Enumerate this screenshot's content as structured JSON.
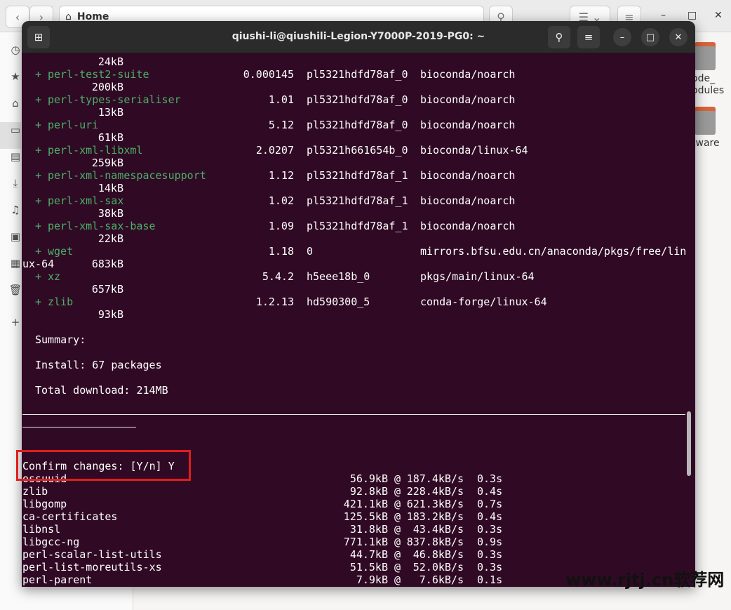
{
  "file_manager": {
    "path_label": "Home",
    "folders": [
      {
        "label": "ode_\nodules"
      },
      {
        "label": "tware"
      }
    ]
  },
  "terminal": {
    "title": "qiushi-li@qiushili-Legion-Y7000P-2019-PG0: ~",
    "packages": [
      {
        "name": "",
        "version": "",
        "build": "",
        "channel": "",
        "size": "24kB"
      },
      {
        "name": "perl-test2-suite",
        "version": "0.000145",
        "build": "pl5321hdfd78af_0",
        "channel": "bioconda/noarch",
        "size": "200kB"
      },
      {
        "name": "perl-types-serialiser",
        "version": "1.01",
        "build": "pl5321hdfd78af_0",
        "channel": "bioconda/noarch",
        "size": "13kB"
      },
      {
        "name": "perl-uri",
        "version": "5.12",
        "build": "pl5321hdfd78af_0",
        "channel": "bioconda/noarch",
        "size": "61kB"
      },
      {
        "name": "perl-xml-libxml",
        "version": "2.0207",
        "build": "pl5321h661654b_0",
        "channel": "bioconda/linux-64",
        "size": "259kB"
      },
      {
        "name": "perl-xml-namespacesupport",
        "version": "1.12",
        "build": "pl5321hdfd78af_1",
        "channel": "bioconda/noarch",
        "size": "14kB"
      },
      {
        "name": "perl-xml-sax",
        "version": "1.02",
        "build": "pl5321hdfd78af_1",
        "channel": "bioconda/noarch",
        "size": "38kB"
      },
      {
        "name": "perl-xml-sax-base",
        "version": "1.09",
        "build": "pl5321hdfd78af_1",
        "channel": "bioconda/noarch",
        "size": "22kB"
      },
      {
        "name": "wget",
        "version": "1.18",
        "build": "0",
        "channel": "mirrors.bfsu.edu.cn/anaconda/pkgs/free/lin",
        "wrap_prefix": "ux-64",
        "size": "683kB"
      },
      {
        "name": "xz",
        "version": "5.4.2",
        "build": "h5eee18b_0",
        "channel": "pkgs/main/linux-64",
        "size": "657kB"
      },
      {
        "name": "zlib",
        "version": "1.2.13",
        "build": "hd590300_5",
        "channel": "conda-forge/linux-64",
        "size": "93kB"
      }
    ],
    "summary_label": "Summary:",
    "install_line": "Install: 67 packages",
    "total_line": "Total download: 214MB",
    "confirm_line": "Confirm changes: [Y/n] Y",
    "downloads": [
      {
        "name": "ossuuid",
        "size": "56.9kB",
        "speed": "187.4kB/s",
        "time": "0.3s"
      },
      {
        "name": "zlib",
        "size": "92.8kB",
        "speed": "228.4kB/s",
        "time": "0.4s"
      },
      {
        "name": "libgomp",
        "size": "421.1kB",
        "speed": "621.3kB/s",
        "time": "0.7s"
      },
      {
        "name": "ca-certificates",
        "size": "125.5kB",
        "speed": "183.2kB/s",
        "time": "0.4s"
      },
      {
        "name": "libnsl",
        "size": "31.8kB",
        "speed": "43.4kB/s",
        "time": "0.3s"
      },
      {
        "name": "libgcc-ng",
        "size": "771.1kB",
        "speed": "837.8kB/s",
        "time": "0.9s"
      },
      {
        "name": "perl-scalar-list-utils",
        "size": "44.7kB",
        "speed": "46.8kB/s",
        "time": "0.3s"
      },
      {
        "name": "perl-list-moreutils-xs",
        "size": "51.5kB",
        "speed": "52.0kB/s",
        "time": "0.3s"
      },
      {
        "name": "perl-parent",
        "size": "7.9kB",
        "speed": "7.6kB/s",
        "time": "0.1s"
      }
    ]
  },
  "watermark": "www.rjtj.cn软荐网",
  "colors": {
    "terminal_bg": "#300a24",
    "package_green": "#4caf6a",
    "highlight_red": "#e11d1d"
  }
}
